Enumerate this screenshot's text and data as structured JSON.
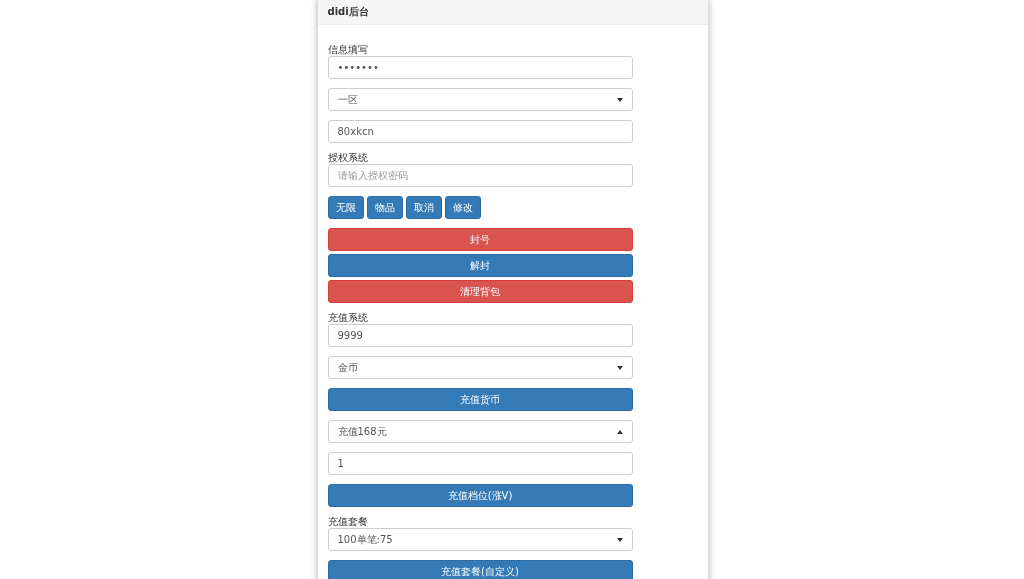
{
  "panel": {
    "title": "didi后台"
  },
  "items": [
    {
      "kind": "label",
      "text": "信息填写"
    },
    {
      "kind": "input",
      "value": "•••••••"
    },
    {
      "kind": "select",
      "value": "一区",
      "expanded": false
    },
    {
      "kind": "input",
      "value": "80xkcn"
    },
    {
      "kind": "label",
      "text": "授权系统"
    },
    {
      "kind": "input",
      "placeholder": "请输入授权密码"
    },
    {
      "kind": "button_row",
      "buttons": [
        "无限",
        "物品",
        "取消",
        "修改"
      ]
    },
    {
      "kind": "button_stack",
      "buttons": [
        {
          "label": "封号",
          "kind": "danger"
        },
        {
          "label": "解封",
          "kind": "primary"
        },
        {
          "label": "清理背包",
          "kind": "danger"
        }
      ]
    },
    {
      "kind": "label",
      "text": "充值系统"
    },
    {
      "kind": "input",
      "value": "9999"
    },
    {
      "kind": "select",
      "value": "金币",
      "expanded": false
    },
    {
      "kind": "button",
      "label": "充值货币"
    },
    {
      "kind": "select",
      "value": "充值168元",
      "expanded": true
    },
    {
      "kind": "input",
      "value": "1"
    },
    {
      "kind": "button",
      "label": "充值档位(涨V)"
    },
    {
      "kind": "label",
      "text": "充值套餐"
    },
    {
      "kind": "select",
      "value": "100单笔:75",
      "expanded": false
    },
    {
      "kind": "button",
      "label": "充值套餐(自定义)"
    }
  ]
}
